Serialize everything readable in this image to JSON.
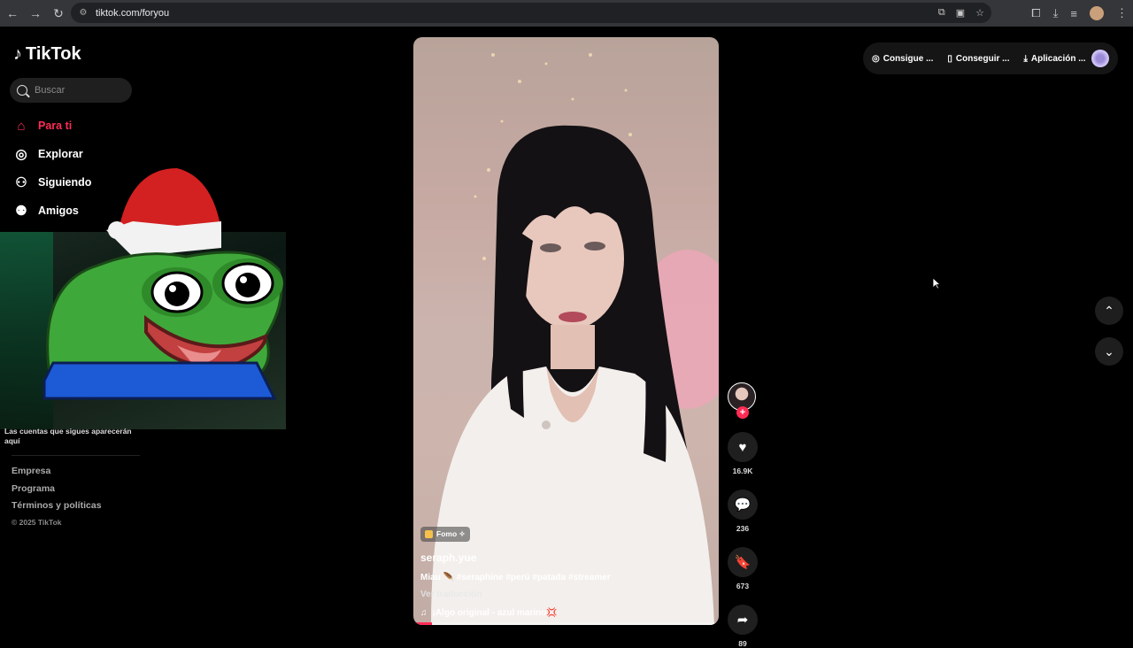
{
  "browser": {
    "url": "tiktok.com/foryou",
    "icons": [
      "back-icon",
      "forward-icon",
      "reload-icon",
      "site-settings-icon",
      "translate-icon",
      "cast-icon",
      "bookmark-star-icon",
      "extension-icon",
      "download-icon",
      "media-icon",
      "profile-icon",
      "menu-icon"
    ]
  },
  "sidebar": {
    "logo": "TikTok",
    "search_placeholder": "Buscar",
    "nav": [
      {
        "label": "Para ti",
        "icon": "home-icon",
        "active": true
      },
      {
        "label": "Explorar",
        "icon": "compass-icon",
        "active": false
      },
      {
        "label": "Siguiendo",
        "icon": "following-icon",
        "active": false
      },
      {
        "label": "Amigos",
        "icon": "friends-icon",
        "active": false
      }
    ],
    "follow_note": "Las cuentas que sigues aparecerán aquí",
    "footer": [
      "Empresa",
      "Programa",
      "Términos y políticas"
    ],
    "copyright": "© 2025 TikTok"
  },
  "video": {
    "effect_tag": "Fomo ✧",
    "username": "seraph.yue",
    "description": "Miau 🪶 #seraphine #perú #patada #streamer",
    "translate": "Ver traducción",
    "music": "¡Algo original - azul marino💢",
    "progress": 0.06
  },
  "actions": {
    "likes": "16.9K",
    "comments": "236",
    "saves": "673",
    "shares": "89"
  },
  "topbar": {
    "items": [
      "Consigue ...",
      "Conseguir ...",
      "Aplicación ..."
    ]
  },
  "colors": {
    "accent": "#fe2c55",
    "background": "#000000"
  }
}
